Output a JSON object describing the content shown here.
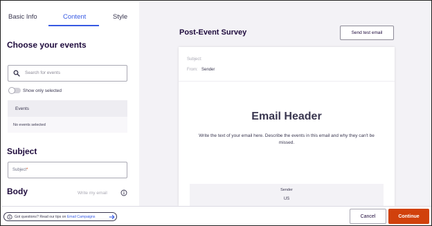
{
  "tabs": [
    {
      "label": "Basic Info",
      "active": false
    },
    {
      "label": "Content",
      "active": true
    },
    {
      "label": "Style",
      "active": false
    }
  ],
  "events_section": {
    "heading": "Choose your events",
    "search_placeholder": "Search for events",
    "toggle_label": "Show only selected",
    "toggle_on": false,
    "table_header": "Events",
    "empty_text": "No events selected"
  },
  "subject_section": {
    "heading": "Subject",
    "placeholder": "Subject",
    "required_mark": "*"
  },
  "body_section": {
    "heading": "Body",
    "write_label": "Write my email"
  },
  "preview": {
    "title": "Post-Event Survey",
    "send_test_label": "Send test email",
    "subject_label": "Subject:",
    "from_label": "From:",
    "from_value": "Sender",
    "email_header": "Email Header",
    "email_body": "Write the text of your email here. Describe the events in this email and why they can't be missed.",
    "footer_sender": "Sender",
    "footer_country": "US"
  },
  "bottom_bar": {
    "help_text": "Got questions? Read our tips on ",
    "help_link": "Email Campaigns",
    "cancel_label": "Cancel",
    "continue_label": "Continue"
  },
  "colors": {
    "accent": "#3659e3",
    "primary_button": "#d1410c",
    "preview_background": "#f3f2f6"
  },
  "icons": [
    "search-icon",
    "toggle-icon",
    "info-icon",
    "arrow-right-icon"
  ]
}
